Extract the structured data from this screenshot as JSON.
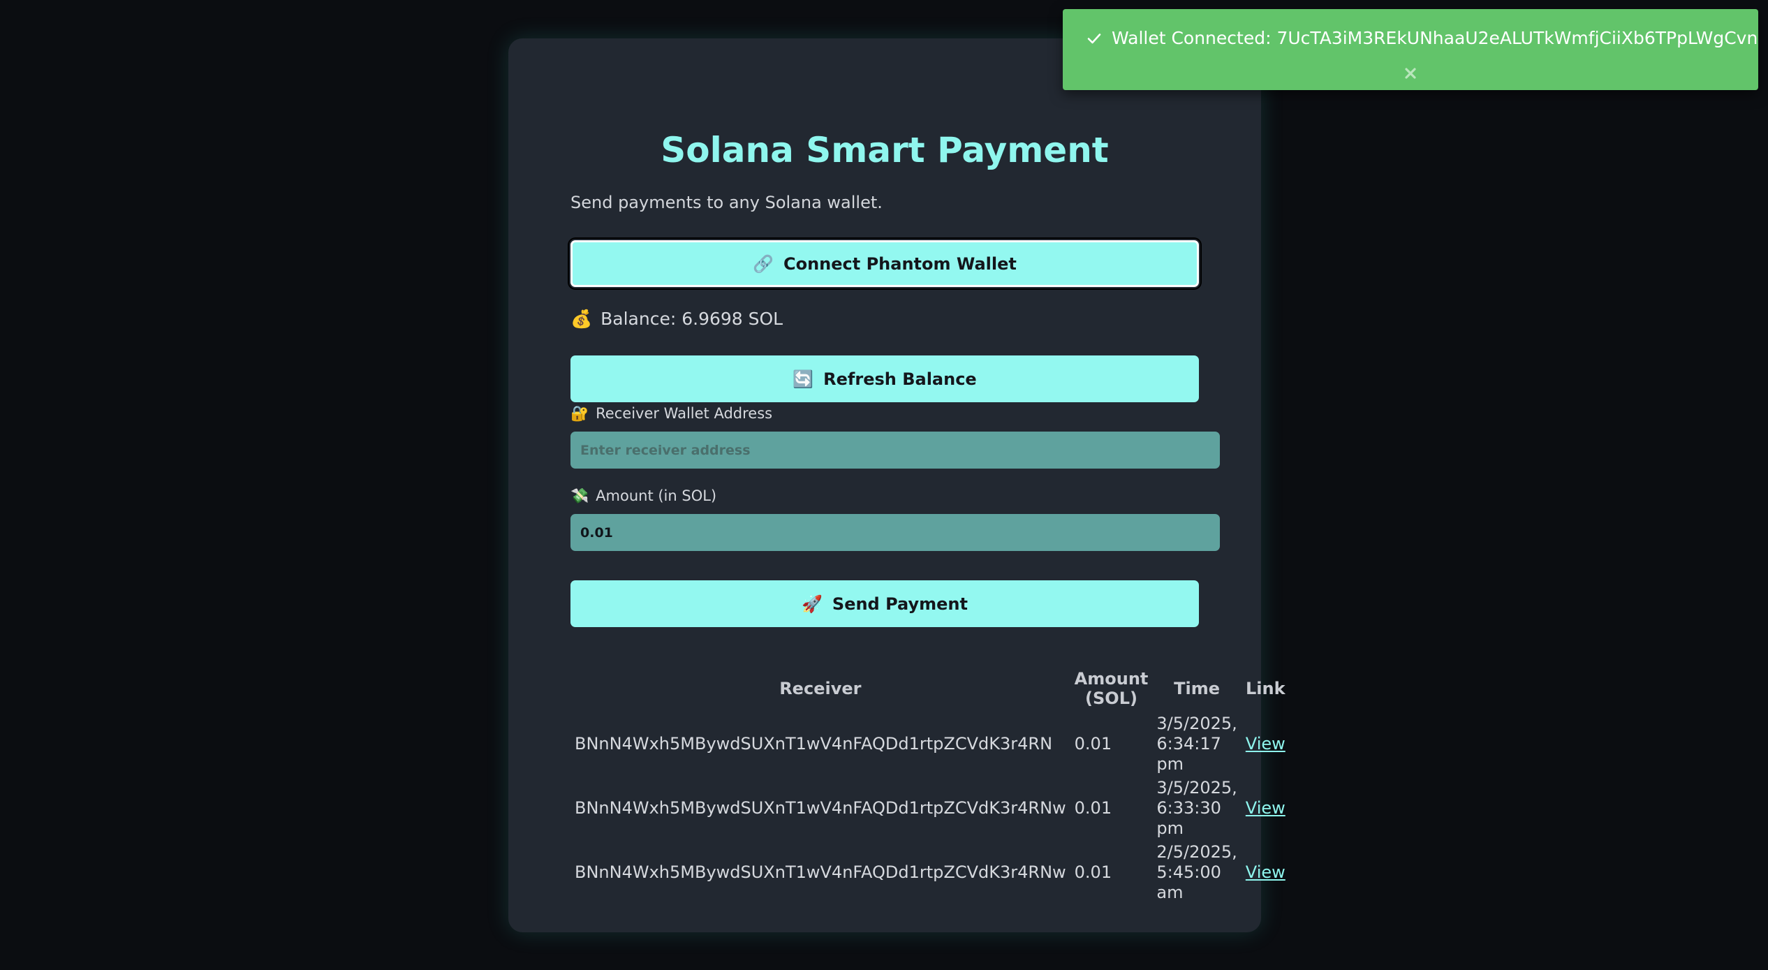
{
  "app": {
    "title": "Solana Smart Payment",
    "subtitle": "Send payments to any Solana wallet."
  },
  "wallet": {
    "connect_icon": "🔗",
    "connect_label": "Connect Phantom Wallet",
    "balance_icon": "💰",
    "balance_text": "Balance: 6.9698 SOL",
    "refresh_icon": "🔄",
    "refresh_label": "Refresh Balance"
  },
  "form": {
    "receiver_icon": "🔐",
    "receiver_label": "Receiver Wallet Address",
    "receiver_placeholder": "Enter receiver address",
    "receiver_value": "",
    "amount_icon": "💸",
    "amount_label": "Amount (in SOL)",
    "amount_value": "0.01",
    "send_icon": "🚀",
    "send_label": "Send Payment"
  },
  "history": {
    "headers": {
      "receiver": "Receiver",
      "amount_line1": "Amount",
      "amount_line2": "(SOL)",
      "time": "Time",
      "link": "Link"
    },
    "rows": [
      {
        "receiver": "BNnN4Wxh5MBywdSUXnT1wV4nFAQDd1rtpZCVdK3r4RN",
        "amount": "0.01",
        "time_date": "3/5/2025,",
        "time_clock": "6:34:17",
        "time_ampm": "pm",
        "link": "View"
      },
      {
        "receiver": "BNnN4Wxh5MBywdSUXnT1wV4nFAQDd1rtpZCVdK3r4RNw",
        "amount": "0.01",
        "time_date": "3/5/2025,",
        "time_clock": "6:33:30",
        "time_ampm": "pm",
        "link": "View"
      },
      {
        "receiver": "BNnN4Wxh5MBywdSUXnT1wV4nFAQDd1rtpZCVdK3r4RNw",
        "amount": "0.01",
        "time_date": "2/5/2025,",
        "time_clock": "5:45:00",
        "time_ampm": "am",
        "link": "View"
      }
    ]
  },
  "toast": {
    "message": "Wallet Connected: 7UcTA3iM3REkUNhaaU2eALUTkWmfjCiiXb6TPpLWgCvn",
    "icon": "check-icon",
    "close_icon": "close-icon"
  },
  "colors": {
    "background": "#0b0d11",
    "card": "#222831",
    "accent": "#8ff6ee",
    "button": "#93f8f0",
    "input": "#5fa29e",
    "toast": "#62c46a"
  }
}
